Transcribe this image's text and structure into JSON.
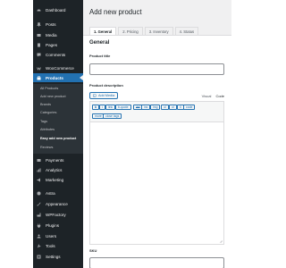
{
  "sidebar": {
    "items": [
      {
        "label": "Dashboard",
        "icon": "dashboard-icon"
      },
      {
        "label": "Posts",
        "icon": "pin-icon"
      },
      {
        "label": "Media",
        "icon": "media-icon"
      },
      {
        "label": "Pages",
        "icon": "page-icon"
      },
      {
        "label": "Comments",
        "icon": "comment-icon"
      },
      {
        "label": "WooCommerce",
        "icon": "woo-icon"
      },
      {
        "label": "Products",
        "icon": "products-icon"
      },
      {
        "label": "Payments",
        "icon": "payments-icon"
      },
      {
        "label": "Analytics",
        "icon": "analytics-icon"
      },
      {
        "label": "Marketing",
        "icon": "megaphone-icon"
      },
      {
        "label": "Astra",
        "icon": "astra-icon"
      },
      {
        "label": "Appearance",
        "icon": "brush-icon"
      },
      {
        "label": "WPFactory",
        "icon": "wpfactory-icon"
      },
      {
        "label": "Plugins",
        "icon": "plugin-icon"
      },
      {
        "label": "Users",
        "icon": "user-icon"
      },
      {
        "label": "Tools",
        "icon": "wrench-icon"
      },
      {
        "label": "Settings",
        "icon": "settings-icon"
      }
    ],
    "submenu": [
      "All Products",
      "Add new product",
      "Brands",
      "Categories",
      "Tags",
      "Attributes",
      "Easy add new product",
      "Reviews"
    ],
    "current_submenu": "Easy add new product"
  },
  "main": {
    "title": "Add new product",
    "tabs": [
      "1. General",
      "2. Pricing",
      "3. Inventory",
      "4. Status"
    ],
    "active_tab": "1. General",
    "section_title": "General",
    "product_title_label": "Product title",
    "product_title_value": "",
    "description_label": "Product description",
    "add_media_label": "Add Media",
    "editor_modes": [
      "Visual",
      "Code"
    ],
    "quicktags": [
      "b",
      "i",
      "link",
      "b-quote",
      "del",
      "ins",
      "img",
      "ul",
      "ol",
      "li",
      "code",
      "more",
      "close tags"
    ],
    "sku_label": "SKU"
  },
  "colors": {
    "sidebar_bg": "#1d2327",
    "accent": "#2271b1",
    "page_bg": "#f0f0f1"
  }
}
